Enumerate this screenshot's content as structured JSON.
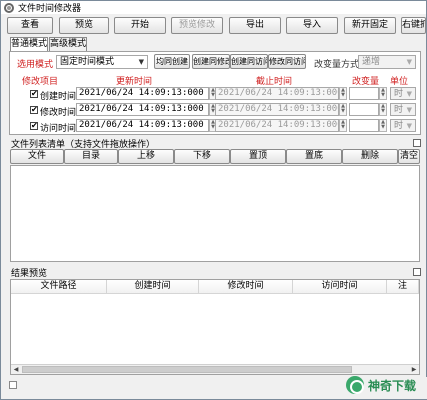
{
  "window": {
    "title": "文件时间修改器"
  },
  "toolbar": {
    "view": "查看",
    "preview": "预览",
    "start": "开始",
    "preview_modify": "预览修改",
    "export": "导出",
    "import": "导入",
    "new_lock": "新开固定",
    "right_key": "右键抓"
  },
  "tabs": {
    "normal": "普通模式",
    "advanced": "高级模式"
  },
  "mode": {
    "label": "选用模式",
    "selected": "固定时间模式",
    "btn_all_create": "均同创建",
    "btn_create_modify": "创建同修改",
    "btn_create_access": "创建同访问",
    "btn_modify_access": "修改同访问",
    "change_label": "改变量方式",
    "change_selected": "递增"
  },
  "columns": {
    "item": "修改项目",
    "update_time": "更新时间",
    "end_time": "截止时间",
    "change_amount": "改变量",
    "unit": "单位"
  },
  "rows": [
    {
      "label": "创建时间",
      "checked": "✔",
      "update": "2021/06/24 14:09:13:000",
      "end": "2021/06/24 14:09:13:000",
      "unit": "时"
    },
    {
      "label": "修改时间",
      "checked": "✔",
      "update": "2021/06/24 14:09:13:000",
      "end": "2021/06/24 14:09:13:000",
      "unit": "时"
    },
    {
      "label": "访问时间",
      "checked": "✔",
      "update": "2021/06/24 14:09:13:000",
      "end": "2021/06/24 14:09:13:000",
      "unit": "时"
    }
  ],
  "filelist": {
    "title": "文件列表清单（支持文件拖放操作）",
    "btn_file": "文件",
    "btn_dir": "目录",
    "btn_up": "上移",
    "btn_down": "下移",
    "btn_top": "置顶",
    "btn_bottom": "置底",
    "btn_delete": "删除",
    "btn_clear": "清空"
  },
  "results": {
    "title": "结果预览",
    "cols": [
      "文件路径",
      "创建时间",
      "修改时间",
      "访问时间",
      "注"
    ]
  },
  "watermark": {
    "text": "神奇下载"
  }
}
